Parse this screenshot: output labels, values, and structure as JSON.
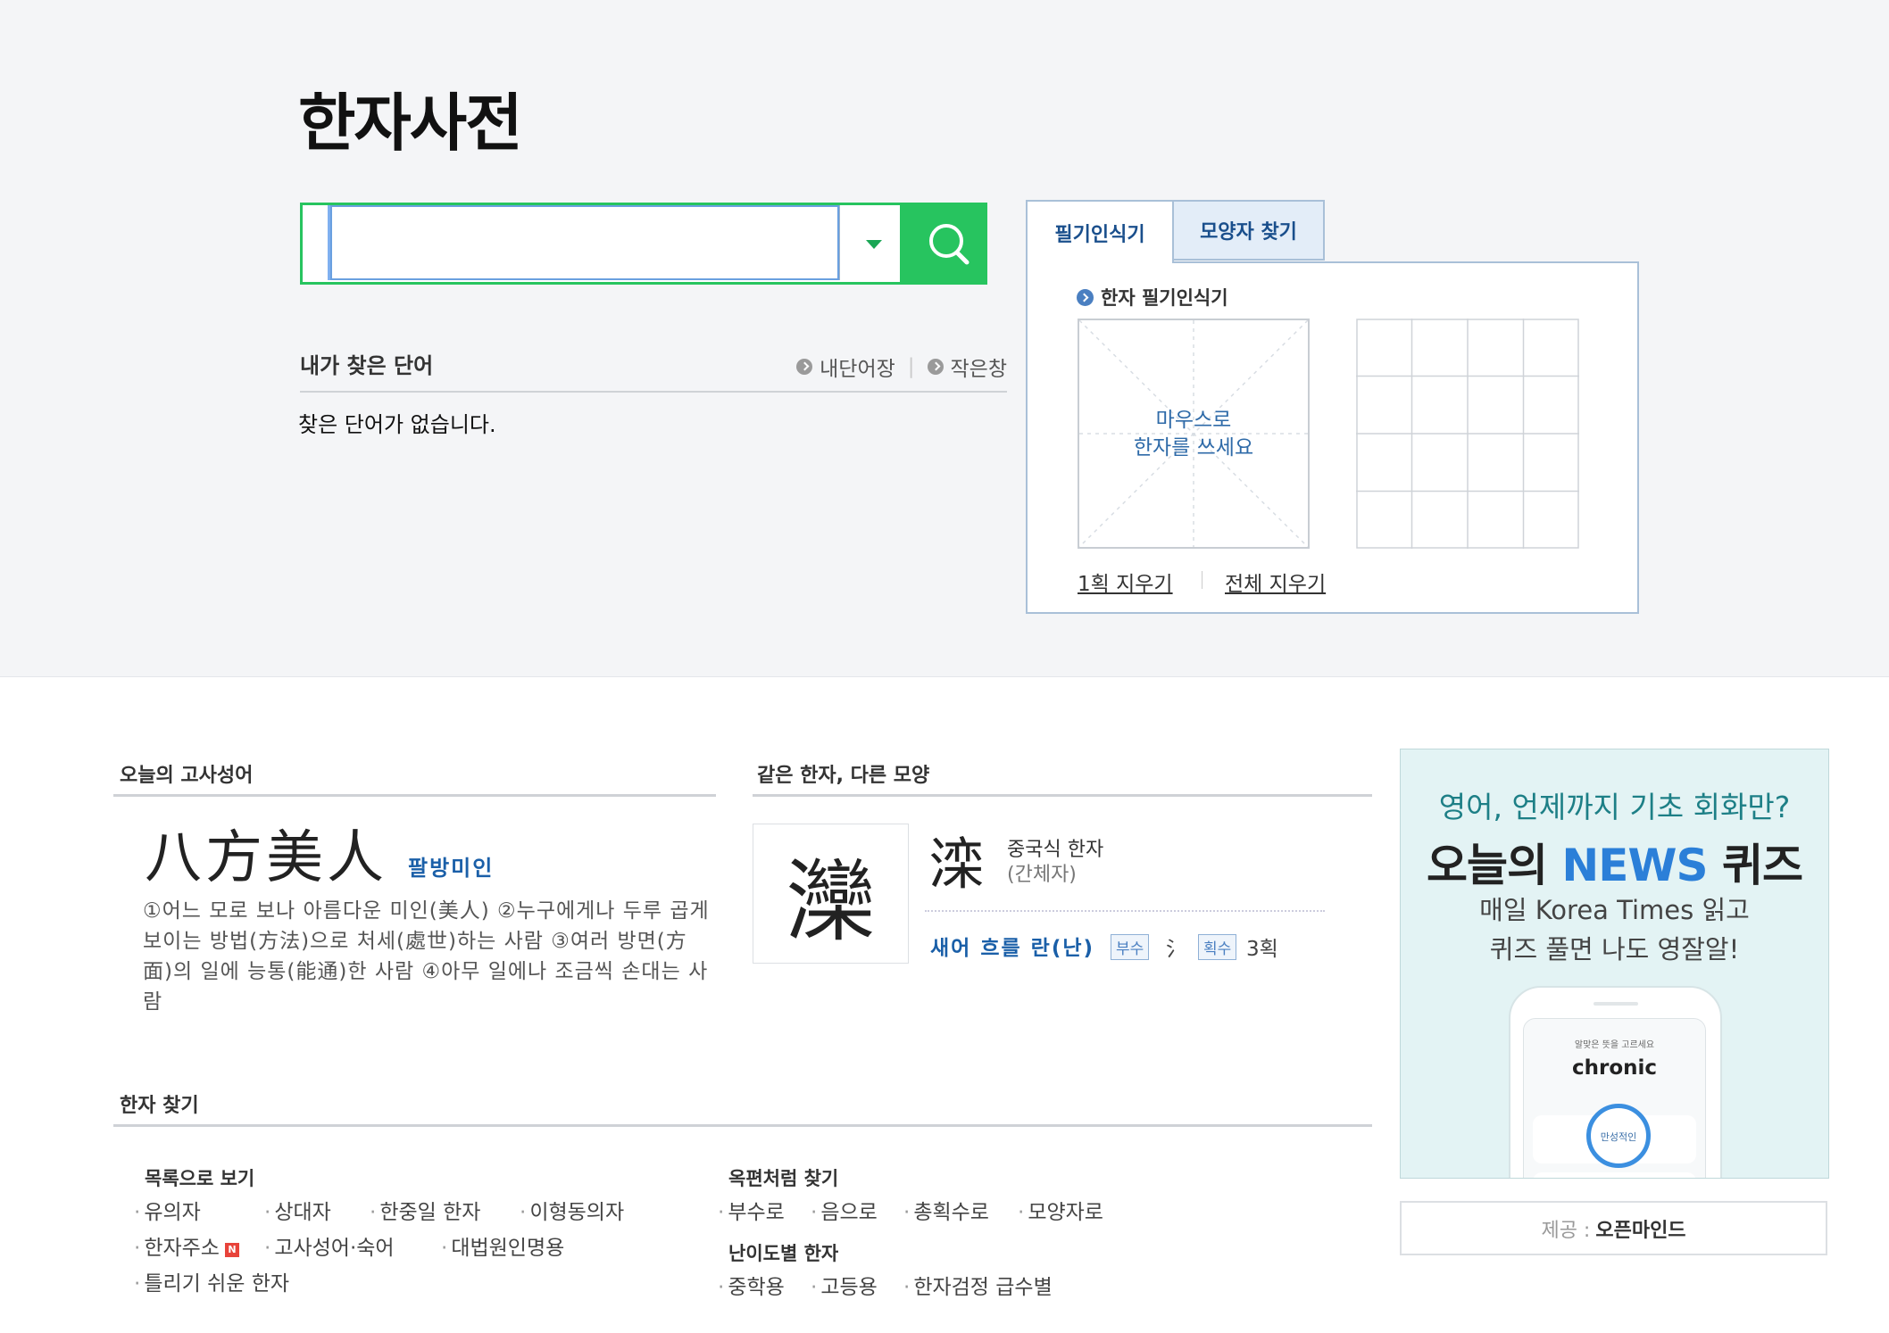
{
  "page_title": "한자사전",
  "search": {
    "value": "",
    "placeholder": ""
  },
  "my_words": {
    "title": "내가 찾은 단어",
    "links": [
      "내단어장",
      "작은창"
    ],
    "empty_message": "찾은 단어가 없습니다."
  },
  "handwriting": {
    "tabs": [
      "필기인식기",
      "모양자 찾기"
    ],
    "label": "한자 필기인식기",
    "canvas_hint_line1": "마우스로",
    "canvas_hint_line2": "한자를 쓰세요",
    "erase_one": "1획 지우기",
    "erase_all": "전체 지우기"
  },
  "idiom_of_day": {
    "title": "오늘의 고사성어",
    "hanja": "八方美人",
    "reading": "팔방미인",
    "description": "①어느 모로 보나 아름다운 미인(美人) ②누구에게나 두루 곱게 보이는 방법(方法)으로 처세(處世)하는 사람 ③여러 방면(方面)의 일에 능통(能通)한 사람 ④아무 일에나 조금씩 손대는 사람"
  },
  "same_hanja": {
    "title": "같은 한자, 다른 모양",
    "traditional": "灤",
    "simplified": "滦",
    "type": "중국식 한자",
    "type_sub": "(간체자)",
    "meaning": "새어 흐를 란(난)",
    "radical_tag": "부수",
    "radical": "氵",
    "strokes_tag": "획수",
    "strokes": "3획"
  },
  "find_hanja": {
    "title": "한자 찾기",
    "list_title": "목록으로 보기",
    "list_links": [
      "유의자",
      "상대자",
      "한중일 한자",
      "이형동의자",
      "한자주소",
      "고사성어·숙어",
      "대법원인명용",
      "틀리기 쉬운 한자"
    ],
    "new_badge": "N",
    "okpyeon_title": "옥편처럼 찾기",
    "okpyeon_links": [
      "부수로",
      "음으로",
      "총획수로",
      "모양자로"
    ],
    "level_title": "난이도별 한자",
    "level_links": [
      "중학용",
      "고등용",
      "한자검정 급수별"
    ]
  },
  "ad": {
    "line1": "영어, 언제까지 기초 회화만?",
    "line2_pre": "오늘의 ",
    "line2_accent": "NEWS",
    "line2_post": " 퀴즈",
    "line3a": "매일 Korea Times 읽고",
    "line3b": "퀴즈 풀면 나도 영잘알!",
    "phone_tip": "알맞은 뜻을 고르세요",
    "phone_word": "chronic",
    "phone_option": "만성적인",
    "provider_label": "제공 :",
    "provider_name": "오픈마인드"
  },
  "colors": {
    "search_green": "#27c45f",
    "link_blue": "#1a5fa8",
    "tab_blue": "#1a4f8c"
  },
  "icons": [
    "search-icon",
    "chevron-down-icon",
    "arrow-right-icon"
  ]
}
